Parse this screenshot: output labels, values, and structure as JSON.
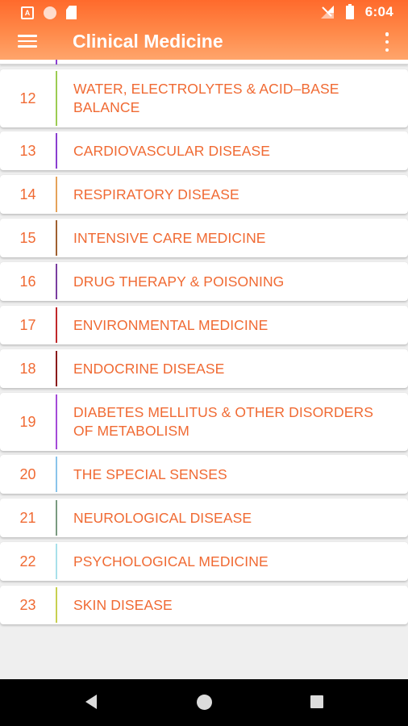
{
  "app_title": "Clinical Medicine",
  "status_bar": {
    "time": "6:04",
    "left_icons": [
      "a-icon",
      "circle-icon",
      "sd-card-icon"
    ],
    "right_icons": [
      "signal-off-icon",
      "battery-icon"
    ]
  },
  "colors": {
    "accent": "#f06a33",
    "toolbar_top": "#ff6a2c",
    "toolbar_bottom": "#ffa56b",
    "background": "#efefef"
  },
  "chapters": [
    {
      "number": "12",
      "title": "WATER, ELECTROLYTES & ACID–BASE BALANCE",
      "bar_color": "#9ccc52"
    },
    {
      "number": "13",
      "title": "CARDIOVASCULAR DISEASE",
      "bar_color": "#8a3fd0"
    },
    {
      "number": "14",
      "title": "RESPIRATORY DISEASE",
      "bar_color": "#e5a25a"
    },
    {
      "number": "15",
      "title": "INTENSIVE CARE MEDICINE",
      "bar_color": "#a06030"
    },
    {
      "number": "16",
      "title": "DRUG THERAPY & POISONING",
      "bar_color": "#7a3ea0"
    },
    {
      "number": "17",
      "title": "ENVIRONMENTAL MEDICINE",
      "bar_color": "#c0282a"
    },
    {
      "number": "18",
      "title": "ENDOCRINE DISEASE",
      "bar_color": "#8a1a1a"
    },
    {
      "number": "19",
      "title": "DIABETES MELLITUS & OTHER DISORDERS OF METABOLISM",
      "bar_color": "#a44ad8"
    },
    {
      "number": "20",
      "title": "THE SPECIAL SENSES",
      "bar_color": "#8ac4ea"
    },
    {
      "number": "21",
      "title": "NEUROLOGICAL DISEASE",
      "bar_color": "#7a9a80"
    },
    {
      "number": "22",
      "title": "PSYCHOLOGICAL MEDICINE",
      "bar_color": "#a8e0ea"
    },
    {
      "number": "23",
      "title": "SKIN DISEASE",
      "bar_color": "#c8d050"
    }
  ],
  "partial_bar_color": "#8a3fd0",
  "nav": {
    "back": "back-icon",
    "home": "home-icon",
    "recents": "recents-icon"
  }
}
